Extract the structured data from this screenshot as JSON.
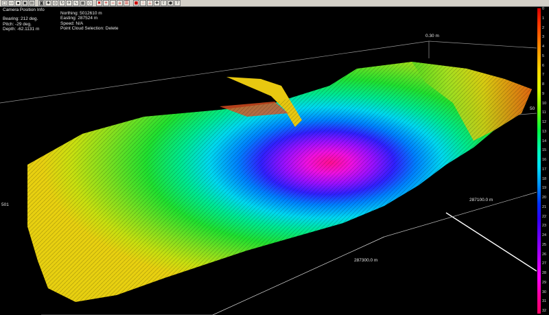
{
  "toolbar": {
    "buttons": [
      {
        "icon": "new-file-icon",
        "glyph": "□"
      },
      {
        "icon": "open-folder-icon",
        "glyph": "▭"
      },
      {
        "icon": "save-icon",
        "glyph": "▪"
      },
      {
        "icon": "save-as-icon",
        "glyph": "▣"
      },
      {
        "icon": "print-icon",
        "glyph": "▤"
      },
      {
        "icon": "camera-icon",
        "glyph": "◙"
      },
      {
        "icon": "settings-icon",
        "glyph": "✱"
      },
      {
        "icon": "navigate-icon",
        "glyph": "◎"
      },
      {
        "icon": "rotate-icon",
        "glyph": "↻"
      },
      {
        "icon": "fly-icon",
        "glyph": "✈"
      },
      {
        "icon": "profile-icon",
        "glyph": "∿"
      },
      {
        "icon": "grid-icon",
        "glyph": "▦"
      },
      {
        "icon": "select-icon",
        "glyph": "◇"
      },
      {
        "icon": "delete-icon",
        "glyph": "✖"
      },
      {
        "icon": "zoom-in-icon",
        "glyph": "+"
      },
      {
        "icon": "zoom-out-icon",
        "glyph": "−"
      },
      {
        "icon": "home-icon",
        "glyph": "⌂"
      },
      {
        "icon": "layers-icon",
        "glyph": "☰"
      },
      {
        "icon": "color-map-icon",
        "glyph": "■"
      },
      {
        "icon": "point-cloud-icon",
        "glyph": "∴"
      },
      {
        "icon": "measure-icon",
        "glyph": "⊥"
      },
      {
        "icon": "marker-icon",
        "glyph": "✚"
      },
      {
        "icon": "export-icon",
        "glyph": "⇪"
      },
      {
        "icon": "record-icon",
        "glyph": "●"
      },
      {
        "icon": "help-icon",
        "glyph": "?"
      }
    ]
  },
  "camera_info": {
    "title": "Camera Position Info",
    "bearing": "Bearing: 212 deg.",
    "pitch": "Pitch: -29 deg.",
    "depth": "Depth: -62.1131 m",
    "northing": "Northing: 5012610 m",
    "easting": "Easting: 287524 m",
    "speed": "Speed: N/A",
    "point_cloud_selection": "Point Cloud Selection: Delete"
  },
  "axis_labels": {
    "top_right_depth": "0.30 m",
    "left_edge": "501",
    "right_edge": "50",
    "easting_right": "287100.0 m",
    "easting_bottom": "287300.0 m"
  },
  "colorbar": {
    "ticks": [
      "0",
      "1",
      "2",
      "3",
      "4",
      "5",
      "6",
      "7",
      "8",
      "9",
      "10",
      "11",
      "12",
      "13",
      "14",
      "15",
      "16",
      "17",
      "18",
      "19",
      "20",
      "21",
      "22",
      "23",
      "24",
      "25",
      "26",
      "27",
      "28",
      "29",
      "30",
      "31",
      "32"
    ]
  },
  "colors": {
    "background": "#000000",
    "toolbar": "#d4d0c8"
  }
}
